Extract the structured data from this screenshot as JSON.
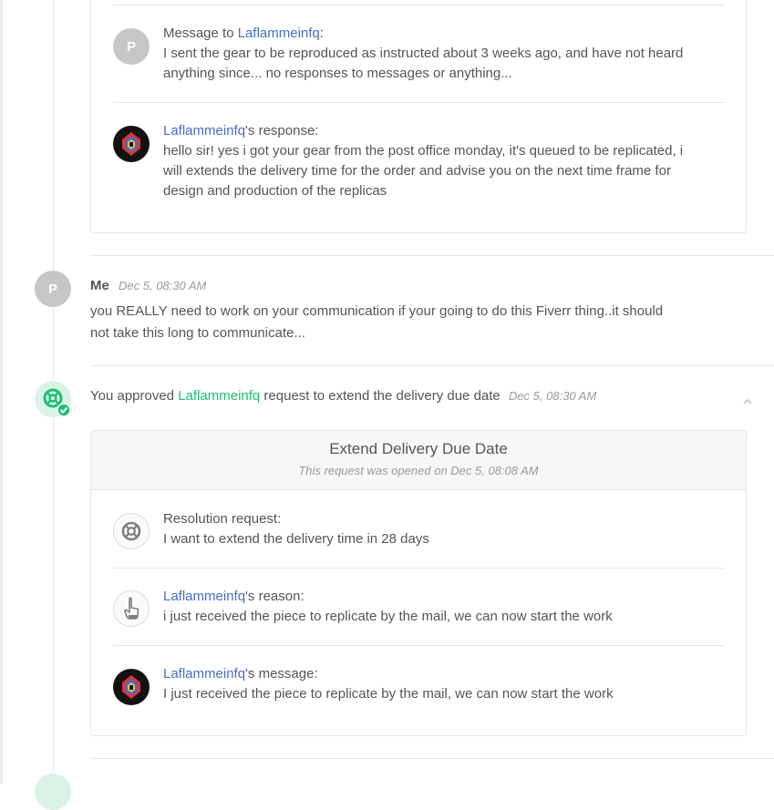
{
  "msg_card": {
    "message_prefix": "Message to ",
    "seller_name": "Laflammeinfq",
    "message_suffix": ":",
    "avatar_letter": "P",
    "message_text": "I sent the gear to be reproduced as instructed about 3 weeks ago, and have not heard anything since... no responses to messages or anything...",
    "response_name": "Laflammeinfq",
    "response_suffix": "'s response:",
    "response_text": "hello sir! yes i got your gear from the post office monday, it's queued to be replicated, i will extends the delivery time for the order and advise you on the next time frame for design and production of the replicas"
  },
  "me_entry": {
    "avatar_letter": "P",
    "author": "Me",
    "timestamp": "Dec 5, 08:30 AM",
    "text": "you REALLY need to work on your communication if your going to do this Fiverr thing..it should not take this long to communicate..."
  },
  "approval": {
    "prefix": "You approved ",
    "seller_name": "Laflammeinfq",
    "suffix": " request to extend the delivery due date",
    "timestamp": "Dec 5, 08:30 AM",
    "icon": "lifebuoy-check-icon",
    "accent_color": "#1dbf73",
    "collapse_icon": "chevron-up-icon"
  },
  "extend_card": {
    "title": "Extend Delivery Due Date",
    "subtitle": "This request was opened on Dec 5, 08:08 AM",
    "resolution_label": "Resolution request:",
    "resolution_text": "I want to extend the delivery time in 28 days",
    "reason_name": "Laflammeinfq",
    "reason_suffix": "'s reason:",
    "reason_text": "i just received the piece to replicate by the mail, we can now start the work",
    "message_name": "Laflammeinfq",
    "message_suffix": "'s message:",
    "message_text": "I just received the piece to replicate by the mail, we can now start the work"
  },
  "colors": {
    "link": "#446ec9",
    "green": "#1dbf73"
  }
}
